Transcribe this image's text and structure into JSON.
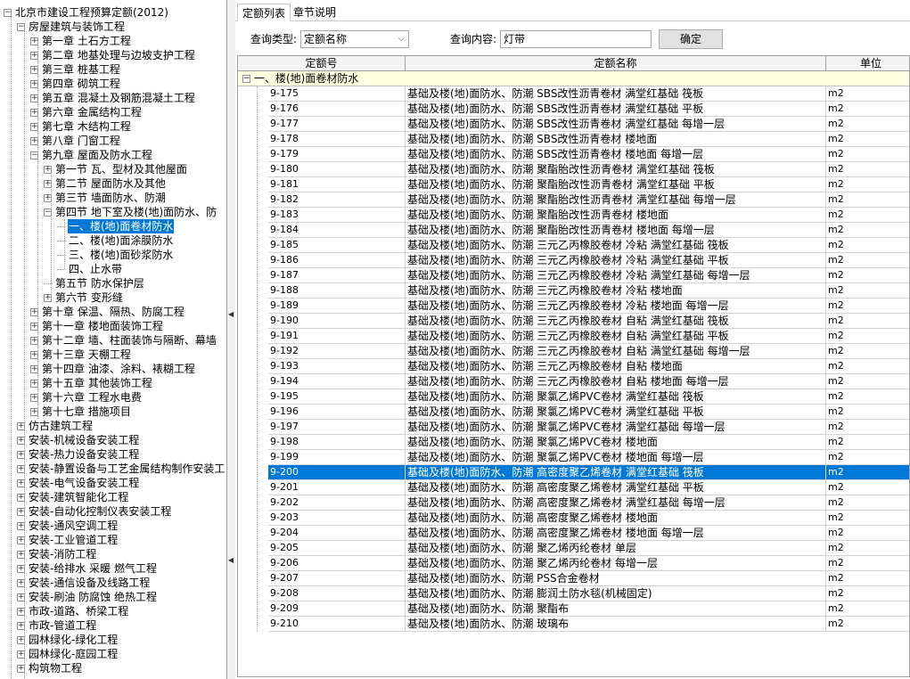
{
  "tree": [
    {
      "level": 0,
      "toggle": "-",
      "label": "北京市建设工程预算定额(2012)"
    },
    {
      "level": 1,
      "toggle": "-",
      "label": "房屋建筑与装饰工程"
    },
    {
      "level": 2,
      "toggle": "+",
      "label": "第一章 土石方工程"
    },
    {
      "level": 2,
      "toggle": "+",
      "label": "第二章 地基处理与边坡支护工程"
    },
    {
      "level": 2,
      "toggle": "+",
      "label": "第三章 桩基工程"
    },
    {
      "level": 2,
      "toggle": "+",
      "label": "第四章 砌筑工程"
    },
    {
      "level": 2,
      "toggle": "+",
      "label": "第五章 混凝土及钢筋混凝土工程"
    },
    {
      "level": 2,
      "toggle": "+",
      "label": "第六章 金属结构工程"
    },
    {
      "level": 2,
      "toggle": "+",
      "label": "第七章 木结构工程"
    },
    {
      "level": 2,
      "toggle": "+",
      "label": "第八章 门窗工程"
    },
    {
      "level": 2,
      "toggle": "-",
      "label": "第九章 屋面及防水工程"
    },
    {
      "level": 3,
      "toggle": "+",
      "label": "第一节 瓦、型材及其他屋面"
    },
    {
      "level": 3,
      "toggle": "+",
      "label": "第二节 屋面防水及其他"
    },
    {
      "level": 3,
      "toggle": "+",
      "label": "第三节 墙面防水、防潮"
    },
    {
      "level": 3,
      "toggle": "-",
      "label": "第四节 地下室及楼(地)面防水、防"
    },
    {
      "level": 4,
      "toggle": "",
      "label": "一、楼(地)面卷材防水",
      "selected": true
    },
    {
      "level": 4,
      "toggle": "",
      "label": "二、楼(地)面涂膜防水"
    },
    {
      "level": 4,
      "toggle": "",
      "label": "三、楼(地)面砂浆防水"
    },
    {
      "level": 4,
      "toggle": "",
      "label": "四、止水带"
    },
    {
      "level": 3,
      "toggle": "",
      "label": "第五节 防水保护层"
    },
    {
      "level": 3,
      "toggle": "+",
      "label": "第六节 变形缝"
    },
    {
      "level": 2,
      "toggle": "+",
      "label": "第十章 保温、隔热、防腐工程"
    },
    {
      "level": 2,
      "toggle": "+",
      "label": "第十一章 楼地面装饰工程"
    },
    {
      "level": 2,
      "toggle": "+",
      "label": "第十二章 墙、柱面装饰与隔断、幕墙"
    },
    {
      "level": 2,
      "toggle": "+",
      "label": "第十三章 天棚工程"
    },
    {
      "level": 2,
      "toggle": "+",
      "label": "第十四章 油漆、涂料、裱糊工程"
    },
    {
      "level": 2,
      "toggle": "+",
      "label": "第十五章 其他装饰工程"
    },
    {
      "level": 2,
      "toggle": "+",
      "label": "第十六章 工程水电费"
    },
    {
      "level": 2,
      "toggle": "+",
      "label": "第十七章 措施项目"
    },
    {
      "level": 1,
      "toggle": "+",
      "label": "仿古建筑工程"
    },
    {
      "level": 1,
      "toggle": "+",
      "label": "安装-机械设备安装工程"
    },
    {
      "level": 1,
      "toggle": "+",
      "label": "安装-热力设备安装工程"
    },
    {
      "level": 1,
      "toggle": "+",
      "label": "安装-静置设备与工艺金属结构制作安装工"
    },
    {
      "level": 1,
      "toggle": "+",
      "label": "安装-电气设备安装工程"
    },
    {
      "level": 1,
      "toggle": "+",
      "label": "安装-建筑智能化工程"
    },
    {
      "level": 1,
      "toggle": "+",
      "label": "安装-自动化控制仪表安装工程"
    },
    {
      "level": 1,
      "toggle": "+",
      "label": "安装-通风空调工程"
    },
    {
      "level": 1,
      "toggle": "+",
      "label": "安装-工业管道工程"
    },
    {
      "level": 1,
      "toggle": "+",
      "label": "安装-消防工程"
    },
    {
      "level": 1,
      "toggle": "+",
      "label": "安装-给排水 采暖 燃气工程"
    },
    {
      "level": 1,
      "toggle": "+",
      "label": "安装-通信设备及线路工程"
    },
    {
      "level": 1,
      "toggle": "+",
      "label": "安装-刷油 防腐蚀 绝热工程"
    },
    {
      "level": 1,
      "toggle": "+",
      "label": "市政-道路、桥梁工程"
    },
    {
      "level": 1,
      "toggle": "+",
      "label": "市政-管道工程"
    },
    {
      "level": 1,
      "toggle": "+",
      "label": "园林绿化-绿化工程"
    },
    {
      "level": 1,
      "toggle": "+",
      "label": "园林绿化-庭园工程"
    },
    {
      "level": 1,
      "toggle": "+",
      "label": "构筑物工程"
    }
  ],
  "tabs": [
    "定额列表",
    "章节说明"
  ],
  "query": {
    "type_label": "查询类型:",
    "type_value": "定额名称",
    "content_label": "查询内容:",
    "content_value": "灯带",
    "confirm_label": "确定"
  },
  "grid": {
    "columns": [
      "定额号",
      "定额名称",
      "单位"
    ],
    "group_label": "一、楼(地)面卷材防水",
    "selected_code": "9-200",
    "rows": [
      {
        "code": "9-175",
        "name": "基础及楼(地)面防水、防潮 SBS改性沥青卷材 满堂红基础 筏板",
        "unit": "m2"
      },
      {
        "code": "9-176",
        "name": "基础及楼(地)面防水、防潮 SBS改性沥青卷材 满堂红基础 平板",
        "unit": "m2"
      },
      {
        "code": "9-177",
        "name": "基础及楼(地)面防水、防潮 SBS改性沥青卷材 满堂红基础 每增一层",
        "unit": "m2"
      },
      {
        "code": "9-178",
        "name": "基础及楼(地)面防水、防潮 SBS改性沥青卷材 楼地面",
        "unit": "m2"
      },
      {
        "code": "9-179",
        "name": "基础及楼(地)面防水、防潮 SBS改性沥青卷材 楼地面 每增一层",
        "unit": "m2"
      },
      {
        "code": "9-180",
        "name": "基础及楼(地)面防水、防潮 聚酯胎改性沥青卷材 满堂红基础 筏板",
        "unit": "m2"
      },
      {
        "code": "9-181",
        "name": "基础及楼(地)面防水、防潮 聚酯胎改性沥青卷材 满堂红基础 平板",
        "unit": "m2"
      },
      {
        "code": "9-182",
        "name": "基础及楼(地)面防水、防潮 聚酯胎改性沥青卷材 满堂红基础 每增一层",
        "unit": "m2"
      },
      {
        "code": "9-183",
        "name": "基础及楼(地)面防水、防潮 聚酯胎改性沥青卷材 楼地面",
        "unit": "m2"
      },
      {
        "code": "9-184",
        "name": "基础及楼(地)面防水、防潮 聚酯胎改性沥青卷材 楼地面 每增一层",
        "unit": "m2"
      },
      {
        "code": "9-185",
        "name": "基础及楼(地)面防水、防潮 三元乙丙橡胶卷材 冷粘 满堂红基础 筏板",
        "unit": "m2"
      },
      {
        "code": "9-186",
        "name": "基础及楼(地)面防水、防潮 三元乙丙橡胶卷材 冷粘 满堂红基础 平板",
        "unit": "m2"
      },
      {
        "code": "9-187",
        "name": "基础及楼(地)面防水、防潮 三元乙丙橡胶卷材 冷粘 满堂红基础 每增一层",
        "unit": "m2"
      },
      {
        "code": "9-188",
        "name": "基础及楼(地)面防水、防潮 三元乙丙橡胶卷材 冷粘 楼地面",
        "unit": "m2"
      },
      {
        "code": "9-189",
        "name": "基础及楼(地)面防水、防潮 三元乙丙橡胶卷材 冷粘 楼地面 每增一层",
        "unit": "m2"
      },
      {
        "code": "9-190",
        "name": "基础及楼(地)面防水、防潮 三元乙丙橡胶卷材 自粘 满堂红基础 筏板",
        "unit": "m2"
      },
      {
        "code": "9-191",
        "name": "基础及楼(地)面防水、防潮 三元乙丙橡胶卷材 自粘 满堂红基础 平板",
        "unit": "m2"
      },
      {
        "code": "9-192",
        "name": "基础及楼(地)面防水、防潮 三元乙丙橡胶卷材 自粘 满堂红基础 每增一层",
        "unit": "m2"
      },
      {
        "code": "9-193",
        "name": "基础及楼(地)面防水、防潮 三元乙丙橡胶卷材 自粘 楼地面",
        "unit": "m2"
      },
      {
        "code": "9-194",
        "name": "基础及楼(地)面防水、防潮 三元乙丙橡胶卷材 自粘 楼地面 每增一层",
        "unit": "m2"
      },
      {
        "code": "9-195",
        "name": "基础及楼(地)面防水、防潮 聚氯乙烯PVC卷材 满堂红基础 筏板",
        "unit": "m2"
      },
      {
        "code": "9-196",
        "name": "基础及楼(地)面防水、防潮 聚氯乙烯PVC卷材 满堂红基础 平板",
        "unit": "m2"
      },
      {
        "code": "9-197",
        "name": "基础及楼(地)面防水、防潮 聚氯乙烯PVC卷材 满堂红基础 每增一层",
        "unit": "m2"
      },
      {
        "code": "9-198",
        "name": "基础及楼(地)面防水、防潮 聚氯乙烯PVC卷材 楼地面",
        "unit": "m2"
      },
      {
        "code": "9-199",
        "name": "基础及楼(地)面防水、防潮 聚氯乙烯PVC卷材 楼地面 每增一层",
        "unit": "m2"
      },
      {
        "code": "9-200",
        "name": "基础及楼(地)面防水、防潮 高密度聚乙烯卷材 满堂红基础 筏板",
        "unit": "m2"
      },
      {
        "code": "9-201",
        "name": "基础及楼(地)面防水、防潮 高密度聚乙烯卷材 满堂红基础 平板",
        "unit": "m2"
      },
      {
        "code": "9-202",
        "name": "基础及楼(地)面防水、防潮 高密度聚乙烯卷材 满堂红基础 每增一层",
        "unit": "m2"
      },
      {
        "code": "9-203",
        "name": "基础及楼(地)面防水、防潮 高密度聚乙烯卷材 楼地面",
        "unit": "m2"
      },
      {
        "code": "9-204",
        "name": "基础及楼(地)面防水、防潮 高密度聚乙烯卷材 楼地面 每增一层",
        "unit": "m2"
      },
      {
        "code": "9-205",
        "name": "基础及楼(地)面防水、防潮 聚乙烯丙纶卷材 单层",
        "unit": "m2"
      },
      {
        "code": "9-206",
        "name": "基础及楼(地)面防水、防潮 聚乙烯丙纶卷材 每增一层",
        "unit": "m2"
      },
      {
        "code": "9-207",
        "name": "基础及楼(地)面防水、防潮 PSS合金卷材",
        "unit": "m2"
      },
      {
        "code": "9-208",
        "name": "基础及楼(地)面防水、防潮 膨润土防水毯(机械固定)",
        "unit": "m2"
      },
      {
        "code": "9-209",
        "name": "基础及楼(地)面防水、防潮 聚酯布",
        "unit": "m2"
      },
      {
        "code": "9-210",
        "name": "基础及楼(地)面防水、防潮 玻璃布",
        "unit": "m2"
      }
    ]
  },
  "colors": {
    "selection": "#0078d7",
    "group_bg": "#ffffe1"
  }
}
